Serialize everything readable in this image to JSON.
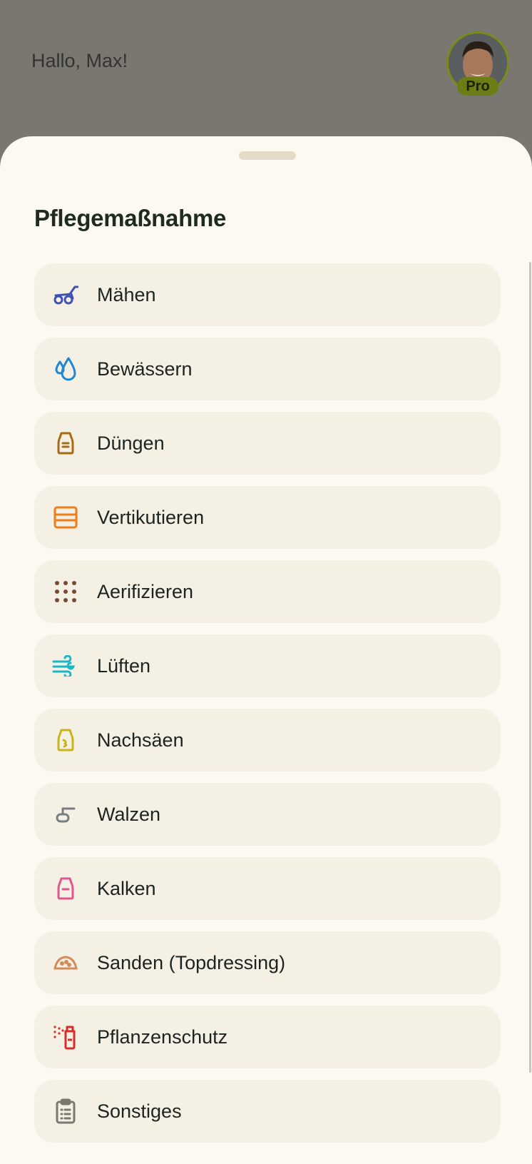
{
  "header": {
    "greeting": "Hallo, Max!",
    "badge": "Pro"
  },
  "sheet": {
    "title": "Pflegemaßnahme",
    "items": [
      {
        "label": "Mähen",
        "icon": "mower-icon",
        "color": "#3f51b5"
      },
      {
        "label": "Bewässern",
        "icon": "water-drops-icon",
        "color": "#1e88d8"
      },
      {
        "label": "Düngen",
        "icon": "fertilizer-bag-icon",
        "color": "#a86a12"
      },
      {
        "label": "Vertikutieren",
        "icon": "scarifier-icon",
        "color": "#ef7d1a"
      },
      {
        "label": "Aerifizieren",
        "icon": "aeration-dots-icon",
        "color": "#7a4a35"
      },
      {
        "label": "Lüften",
        "icon": "wind-icon",
        "color": "#19b8c8"
      },
      {
        "label": "Nachsäen",
        "icon": "seed-bag-icon",
        "color": "#c9b41a"
      },
      {
        "label": "Walzen",
        "icon": "roller-icon",
        "color": "#7a7d80"
      },
      {
        "label": "Kalken",
        "icon": "lime-bag-icon",
        "color": "#e0568f"
      },
      {
        "label": "Sanden (Topdressing)",
        "icon": "sand-pile-icon",
        "color": "#d28c5c"
      },
      {
        "label": "Pflanzenschutz",
        "icon": "spray-bottle-icon",
        "color": "#d92c2c"
      },
      {
        "label": "Sonstiges",
        "icon": "clipboard-icon",
        "color": "#7a7870"
      }
    ]
  }
}
